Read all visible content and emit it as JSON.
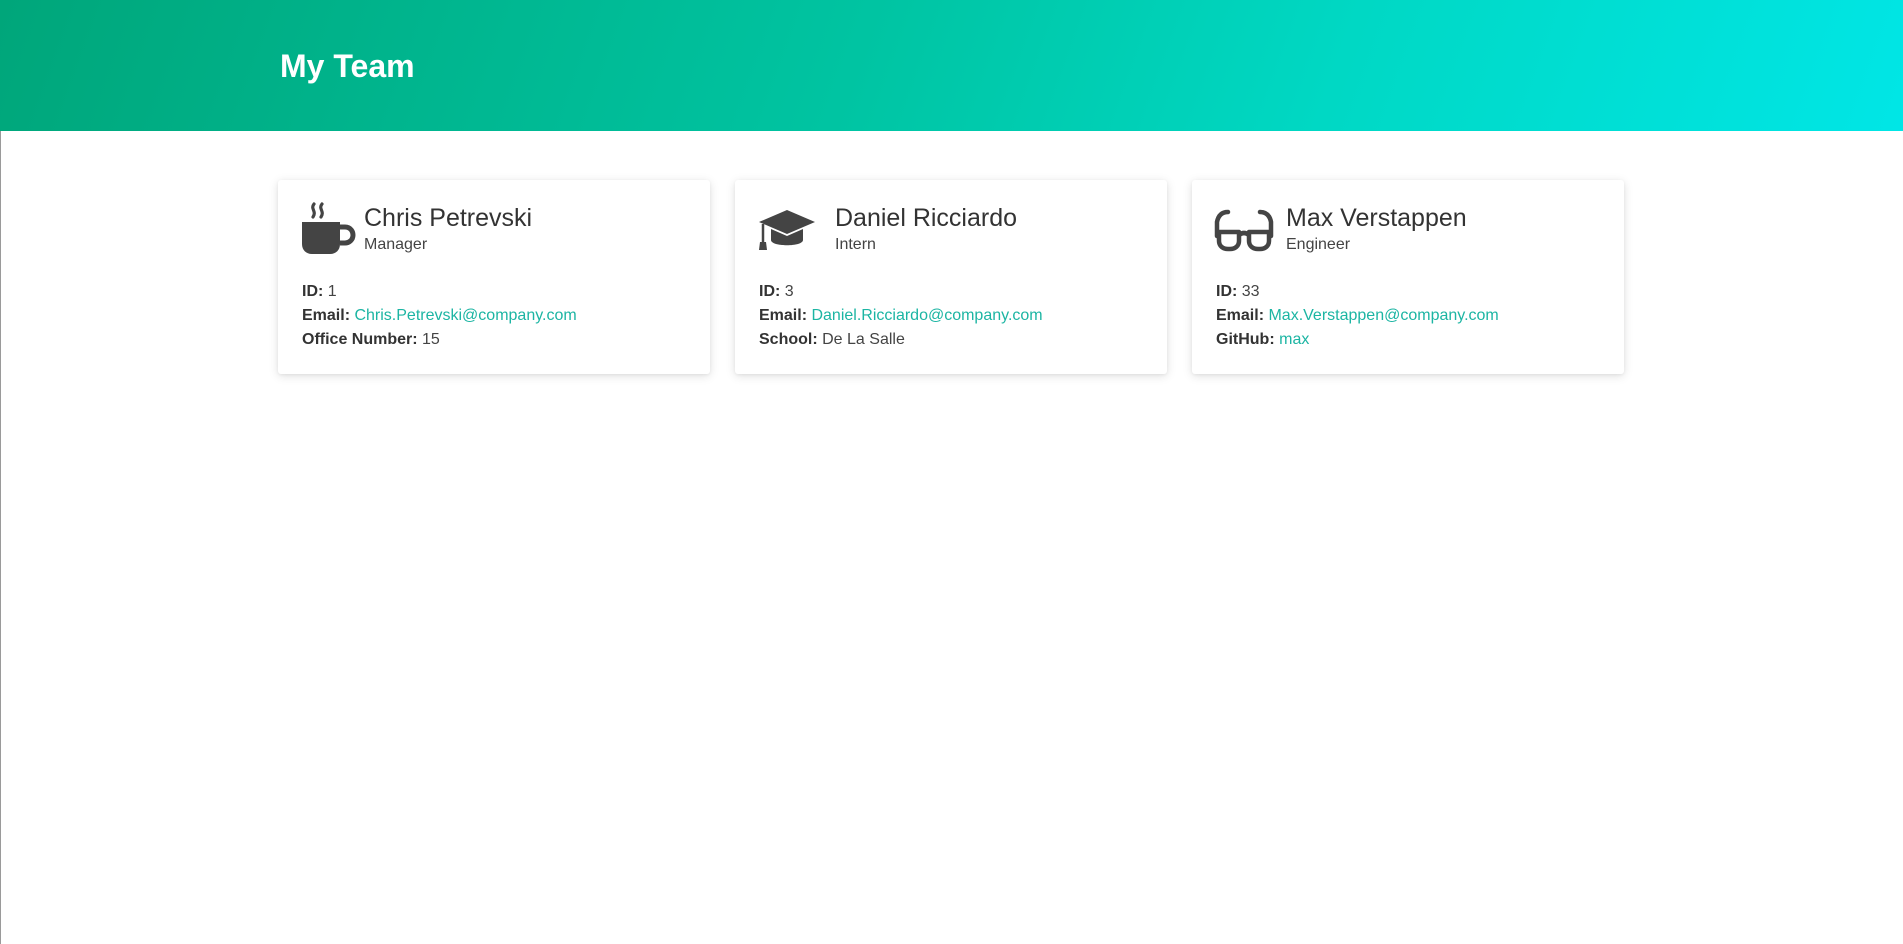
{
  "header": {
    "title": "My Team"
  },
  "cards": [
    {
      "icon": "coffee-mug-icon",
      "name": "Chris Petrevski",
      "role": "Manager",
      "id_label": "ID:",
      "id": "1",
      "email_label": "Email:",
      "email": "Chris.Petrevski@company.com",
      "extra_label": "Office Number:",
      "extra_value": "15"
    },
    {
      "icon": "graduation-cap-icon",
      "name": "Daniel Ricciardo",
      "role": "Intern",
      "id_label": "ID:",
      "id": "3",
      "email_label": "Email:",
      "email": "Daniel.Ricciardo@company.com",
      "extra_label": "School:",
      "extra_value": "De La Salle"
    },
    {
      "icon": "glasses-icon",
      "name": "Max Verstappen",
      "role": "Engineer",
      "id_label": "ID:",
      "id": "33",
      "email_label": "Email:",
      "email": "Max.Verstappen@company.com",
      "extra_label": "GitHub:",
      "extra_value": "max"
    }
  ],
  "colors": {
    "header_gradient_start": "#00a67a",
    "header_gradient_end": "#00e6e6",
    "link": "#1cb5a3",
    "icon": "#444444"
  }
}
